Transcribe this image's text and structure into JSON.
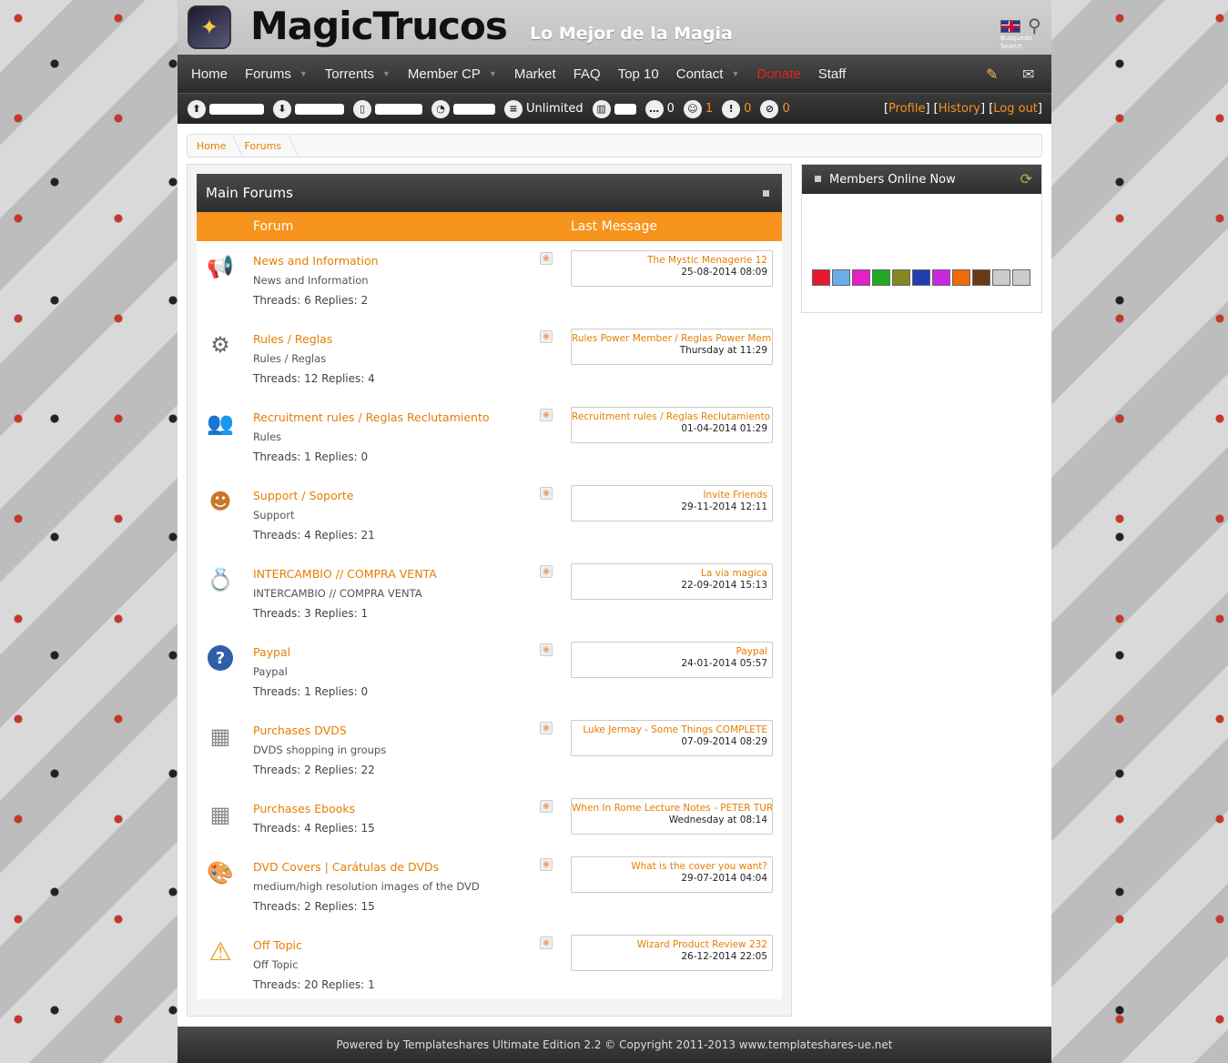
{
  "header": {
    "site_name": "MagicTrucos",
    "tagline": "Lo Mejor de la Magia",
    "search_caption_line1": "Busqueda",
    "search_caption_line2": "Search"
  },
  "nav": {
    "items": [
      {
        "label": "Home",
        "dropdown": false
      },
      {
        "label": "Forums",
        "dropdown": true
      },
      {
        "label": "Torrents",
        "dropdown": true
      },
      {
        "label": "Member CP",
        "dropdown": true
      },
      {
        "label": "Market",
        "dropdown": false
      },
      {
        "label": "FAQ",
        "dropdown": false
      },
      {
        "label": "Top 10",
        "dropdown": false
      },
      {
        "label": "Contact",
        "dropdown": true
      },
      {
        "label": "Donate",
        "dropdown": false
      },
      {
        "label": "Staff",
        "dropdown": false
      }
    ],
    "right_icons": [
      "bell-icon",
      "mail-icon"
    ]
  },
  "stats": {
    "unlimited_label": "Unlimited",
    "messages": "0",
    "friends": "1",
    "warnings": "0",
    "bans": "0",
    "links": {
      "profile": "Profile",
      "history": "History",
      "logout": "Log out"
    }
  },
  "breadcrumb": [
    "Home",
    "Forums"
  ],
  "main": {
    "title": "Main Forums",
    "col_forum": "Forum",
    "col_last": "Last Message",
    "forums": [
      {
        "title": "News and Information",
        "desc": "News and Information",
        "stats": "Threads: 6 Replies: 2",
        "last_title": "The Mystic Menagerie 12",
        "last_date": "25-08-2014 08:09",
        "icon": "megaphone-icon"
      },
      {
        "title": "Rules / Reglas",
        "desc": "Rules / Reglas",
        "stats": "Threads: 12 Replies: 4",
        "last_title": "Rules Power Member / Reglas Power Member",
        "last_date": "Thursday at 11:29",
        "icon": "gears-icon"
      },
      {
        "title": "Recruitment rules / Reglas Reclutamiento",
        "desc": "Rules",
        "stats": "Threads: 1 Replies: 0",
        "last_title": "Recruitment rules / Reglas Reclutamiento",
        "last_date": "01-04-2014 01:29",
        "icon": "users-icon"
      },
      {
        "title": "Support / Soporte",
        "desc": "Support",
        "stats": "Threads: 4 Replies: 21",
        "last_title": "Invite Friends",
        "last_date": "29-11-2014 12:11",
        "icon": "support-user-icon"
      },
      {
        "title": "INTERCAMBIO // COMPRA VENTA",
        "desc": "INTERCAMBIO // COMPRA VENTA",
        "stats": "Threads: 3 Replies: 1",
        "last_title": "La via magica",
        "last_date": "22-09-2014 15:13",
        "icon": "ring-icon"
      },
      {
        "title": "Paypal",
        "desc": "Paypal",
        "stats": "Threads: 1 Replies: 0",
        "last_title": "Paypal",
        "last_date": "24-01-2014 05:57",
        "icon": "question-icon"
      },
      {
        "title": "Purchases DVDS",
        "desc": "DVDS shopping in groups",
        "stats": "Threads: 2 Replies: 22",
        "last_title": "Luke Jermay - Some Things COMPLETE",
        "last_date": "07-09-2014 08:29",
        "icon": "newspaper-icon"
      },
      {
        "title": "Purchases Ebooks",
        "desc": "",
        "stats": "Threads: 4 Replies: 15",
        "last_title": "When In Rome Lecture Notes - PETER TURN",
        "last_date": "Wednesday at 08:14",
        "icon": "newspaper-icon"
      },
      {
        "title": "DVD Covers | Carátulas de DVDs",
        "desc": "medium/high resolution images of the DVD",
        "stats": "Threads: 2 Replies: 15",
        "last_title": "What is the cover you want?",
        "last_date": "29-07-2014 04:04",
        "icon": "palette-icon"
      },
      {
        "title": "Off Topic",
        "desc": "Off Topic",
        "stats": "Threads: 20 Replies: 1",
        "last_title": "Wizard Product Review 232",
        "last_date": "26-12-2014 22:05",
        "icon": "warning-icon"
      }
    ]
  },
  "sidebar": {
    "title": "Members Online Now",
    "swatch_colors": [
      "#e8192c",
      "#6aaee8",
      "#e81ec8",
      "#22a822",
      "#878722",
      "#1e3fb4",
      "#c828e0",
      "#f06a0a",
      "#6b3a14",
      "#cccccc",
      "#cccccc"
    ]
  },
  "footer": {
    "text": "Powered by Templateshares Ultimate Edition 2.2 © Copyright 2011-2013 www.templateshares-ue.net"
  }
}
